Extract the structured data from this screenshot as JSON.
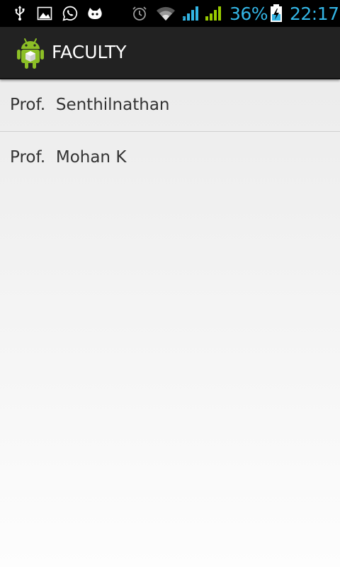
{
  "status_bar": {
    "left_icons": [
      "usb-icon",
      "gallery-icon",
      "whatsapp-icon",
      "notification-app-icon"
    ],
    "right_icons": [
      "alarm-icon",
      "wifi-icon",
      "signal-icon",
      "signal-icon",
      "battery-charging-icon"
    ],
    "battery_percent": "36%",
    "time": "22:17",
    "accent_color": "#33b5e5"
  },
  "action_bar": {
    "app_icon": "android-logo-icon",
    "title": "FACULTY",
    "background": "#222222"
  },
  "faculty_list": {
    "items": [
      {
        "label": "Prof.  Senthilnathan"
      },
      {
        "label": "Prof.  Mohan K"
      }
    ]
  }
}
